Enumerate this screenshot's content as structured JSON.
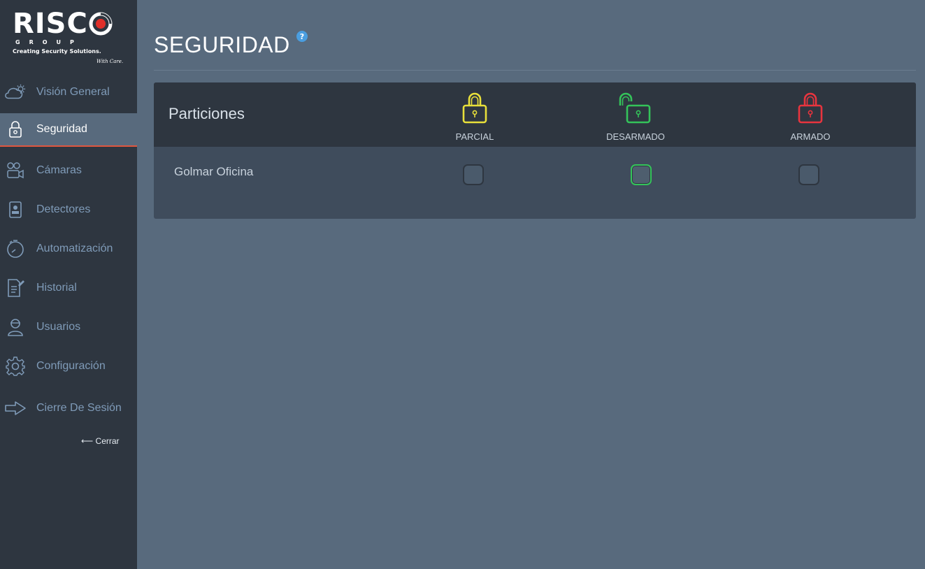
{
  "brand": {
    "name": "RISC",
    "group": "GROUP",
    "tagline": "Creating Security Solutions.",
    "tagline_suffix": "With Care."
  },
  "sidebar": {
    "items": [
      {
        "label": "Visión General",
        "icon": "cloud-sun-icon",
        "active": false
      },
      {
        "label": "Seguridad",
        "icon": "padlock-icon",
        "active": true
      },
      {
        "label": "Cámaras",
        "icon": "camera-icon",
        "active": false
      },
      {
        "label": "Detectores",
        "icon": "detector-icon",
        "active": false
      },
      {
        "label": "Automatización",
        "icon": "timer-icon",
        "active": false
      },
      {
        "label": "Historial",
        "icon": "document-pen-icon",
        "active": false
      },
      {
        "label": "Usuarios",
        "icon": "user-icon",
        "active": false
      },
      {
        "label": "Configuración",
        "icon": "gear-icon",
        "active": false
      },
      {
        "label": "Cierre De Sesión",
        "icon": "logout-arrow-icon",
        "active": false
      }
    ],
    "close_label": "⟵ Cerrar"
  },
  "main": {
    "title": "SEGURIDAD",
    "help_icon": "?",
    "panel": {
      "title": "Particiones",
      "columns": [
        {
          "label": "PARCIAL",
          "icon": "lock-closed-icon",
          "color": "#e8e03a"
        },
        {
          "label": "DESARMADO",
          "icon": "lock-open-icon",
          "color": "#34c35a"
        },
        {
          "label": "ARMADO",
          "icon": "lock-closed-icon",
          "color": "#e8343e"
        }
      ],
      "rows": [
        {
          "name": "Golmar Oficina",
          "state": "DESARMADO"
        }
      ]
    }
  },
  "colors": {
    "sidebar_bg": "#2e3640",
    "main_bg": "#586a7d",
    "active_underline": "#e0563f",
    "nav_text": "#7f9bb8"
  }
}
